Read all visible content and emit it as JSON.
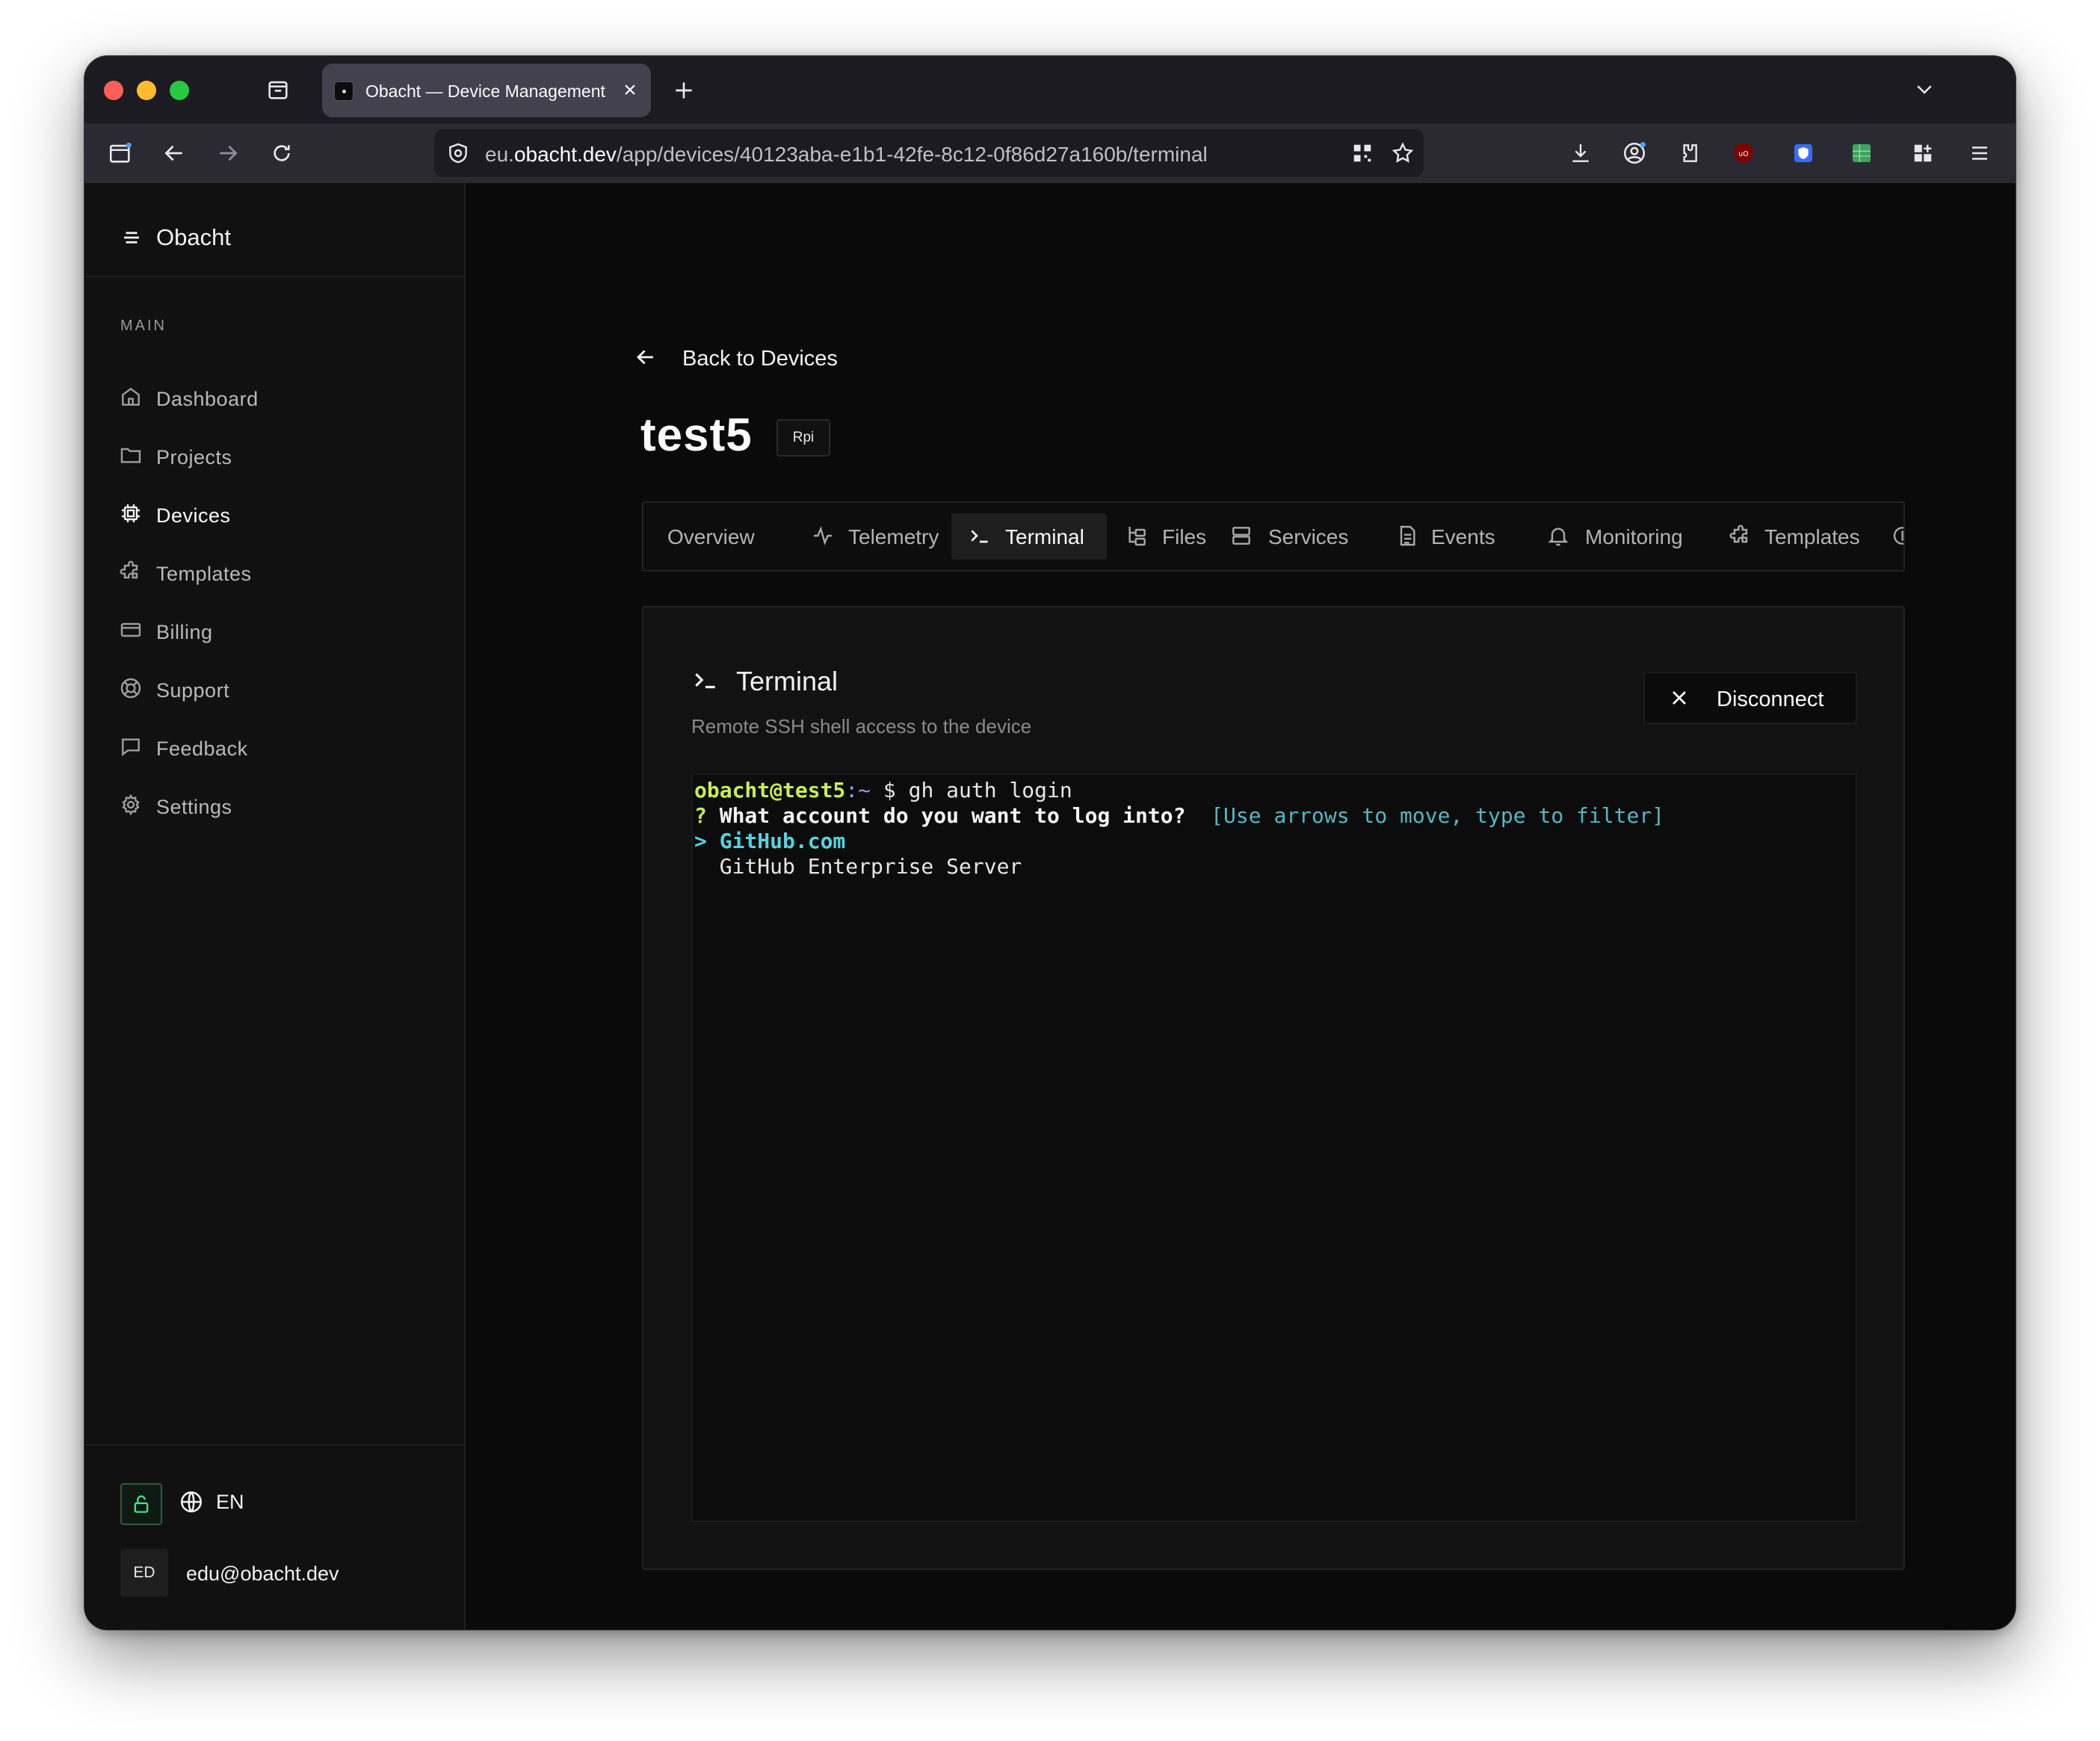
{
  "browser": {
    "tab_title": "Obacht — Device Management",
    "url_domain_prefix": "eu.",
    "url_domain": "obacht.dev",
    "url_path": "/app/devices/40123aba-e1b1-42fe-8c12-0f86d27a160b/terminal"
  },
  "sidebar": {
    "brand": "Obacht",
    "section_label": "MAIN",
    "items": [
      {
        "label": "Dashboard",
        "icon": "home-icon"
      },
      {
        "label": "Projects",
        "icon": "folder-icon"
      },
      {
        "label": "Devices",
        "icon": "chip-icon",
        "active": true
      },
      {
        "label": "Templates",
        "icon": "puzzle-icon"
      },
      {
        "label": "Billing",
        "icon": "credit-card-icon"
      },
      {
        "label": "Support",
        "icon": "lifebuoy-icon"
      },
      {
        "label": "Feedback",
        "icon": "message-square-icon"
      },
      {
        "label": "Settings",
        "icon": "gear-icon"
      }
    ],
    "language": "EN",
    "user_initials": "ED",
    "user_email": "edu@obacht.dev"
  },
  "page": {
    "back_label": "Back to Devices",
    "device_name": "test5",
    "device_badge": "Rpi",
    "tabs": [
      {
        "label": "Overview"
      },
      {
        "label": "Telemetry",
        "icon": "activity-icon"
      },
      {
        "label": "Terminal",
        "icon": "terminal-icon",
        "active": true
      },
      {
        "label": "Files",
        "icon": "folder-tree-icon"
      },
      {
        "label": "Services",
        "icon": "server-icon"
      },
      {
        "label": "Events",
        "icon": "file-text-icon"
      },
      {
        "label": "Monitoring",
        "icon": "bell-icon"
      },
      {
        "label": "Templates",
        "icon": "puzzle-icon"
      }
    ]
  },
  "terminal_card": {
    "title": "Terminal",
    "subtitle": "Remote SSH shell access to the device",
    "disconnect_label": "Disconnect",
    "prompt_user": "obacht@test5",
    "prompt_path": ":~",
    "prompt_symbol": " $ ",
    "command": "gh auth login",
    "question_mark": "? ",
    "question": "What account do you want to log into?",
    "hint": "  [Use arrows to move, type to filter]",
    "selected_marker": "> ",
    "option_selected": "GitHub.com",
    "option_other": "  GitHub Enterprise Server"
  },
  "colors": {
    "accent_green": "#4ade80",
    "terminal_prompt": "#c6ef53",
    "terminal_cyan": "#53b8c6"
  }
}
